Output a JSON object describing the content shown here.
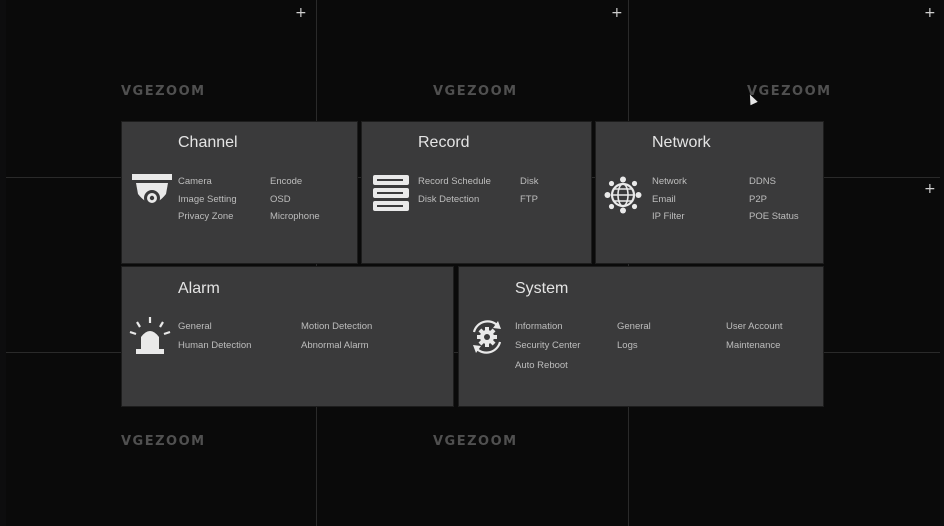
{
  "brand_watermark": "VGEZOOM",
  "menu": {
    "channel": {
      "title": "Channel",
      "items": [
        "Camera",
        "Encode",
        "Image Setting",
        "OSD",
        "Privacy Zone",
        "Microphone"
      ]
    },
    "record": {
      "title": "Record",
      "items": [
        "Record Schedule",
        "Disk",
        "Disk Detection",
        "FTP"
      ]
    },
    "network": {
      "title": "Network",
      "items": [
        "Network",
        "DDNS",
        "Email",
        "P2P",
        "IP Filter",
        "POE Status"
      ]
    },
    "alarm": {
      "title": "Alarm",
      "items": [
        "General",
        "Motion Detection",
        "Human Detection",
        "Abnormal Alarm"
      ]
    },
    "system": {
      "title": "System",
      "items": [
        "Information",
        "General",
        "User Account",
        "Security Center",
        "Logs",
        "Maintenance",
        "Auto Reboot"
      ]
    }
  },
  "colors": {
    "panel_bg": "#3a3a3b",
    "screen_bg": "#0a0a0a",
    "text": "#bdbdbd",
    "title": "#e4e4e4"
  },
  "icons": {
    "channel": "dome-camera-icon",
    "record": "hard-disk-icon",
    "network": "globe-network-icon",
    "alarm": "alarm-light-icon",
    "system": "gear-icon",
    "add": "plus-icon"
  }
}
